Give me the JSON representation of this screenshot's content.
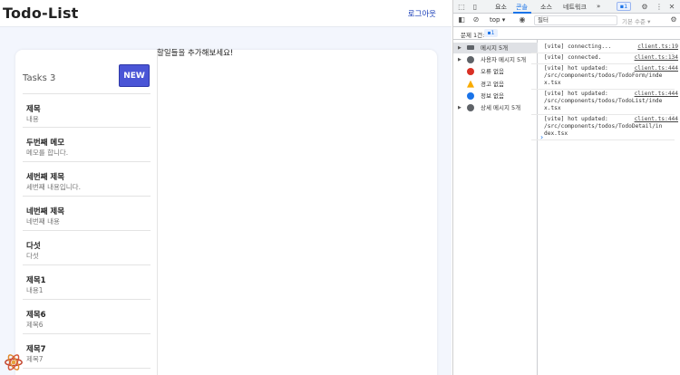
{
  "app": {
    "title": "Todo-List",
    "logout_label": "로그아웃",
    "tasks_label": "Tasks 3",
    "new_button": "NEW",
    "detail_message": "할일들을 추가해보세요!",
    "todos": [
      {
        "title": "제목",
        "content": "내용"
      },
      {
        "title": "두번째 메모",
        "content": "메모를 합니다."
      },
      {
        "title": "세번째 제목",
        "content": "세번째 내용입니다."
      },
      {
        "title": "네번째 제목",
        "content": "네번째 내용"
      },
      {
        "title": "다섯",
        "content": "다섯"
      },
      {
        "title": "제목1",
        "content": "내용1"
      },
      {
        "title": "제목6",
        "content": "제목6"
      },
      {
        "title": "제목7",
        "content": "제목7"
      }
    ]
  },
  "devtools": {
    "tabs": [
      "요소",
      "콘솔",
      "소스",
      "네트워크"
    ],
    "active_tab": "콘솔",
    "more_tabs": "»",
    "issue_badge": "1",
    "context": "top",
    "filter_placeholder": "필터",
    "levels": "기본 수준",
    "issues_label": "문제 1건:",
    "issues_count": "1",
    "sidebar": [
      {
        "label": "메시지 5개",
        "icon": "list-icon",
        "arrow": "▶"
      },
      {
        "label": "사용자 메시지 5개",
        "icon": "user-icon",
        "arrow": "▶"
      },
      {
        "label": "오류 없음",
        "icon": "error-icon",
        "arrow": ""
      },
      {
        "label": "경고 없음",
        "icon": "warning-icon",
        "arrow": ""
      },
      {
        "label": "정보 없음",
        "icon": "info-icon",
        "arrow": ""
      },
      {
        "label": "상세 메시지 5개",
        "icon": "bug-icon",
        "arrow": "▶"
      }
    ],
    "logs": [
      {
        "text": "[vite] connecting...",
        "source": "client.ts:19"
      },
      {
        "text": "[vite] connected.",
        "source": "client.ts:134"
      },
      {
        "text": "[vite] hot updated:\n/src/components/todos/TodoForm/inde\nx.tsx",
        "source": "client.ts:444"
      },
      {
        "text": "[vite] hot updated:\n/src/components/todos/TodoList/inde\nx.tsx",
        "source": "client.ts:444"
      },
      {
        "text": "[vite] hot updated:\n/src/components/todos/TodoDetail/in\ndex.tsx",
        "source": "client.ts:444"
      }
    ],
    "prompt": "›"
  },
  "colors": {
    "accent": "#4a55d6",
    "link": "#1b3fb8",
    "devtools_blue": "#1a73e8"
  }
}
